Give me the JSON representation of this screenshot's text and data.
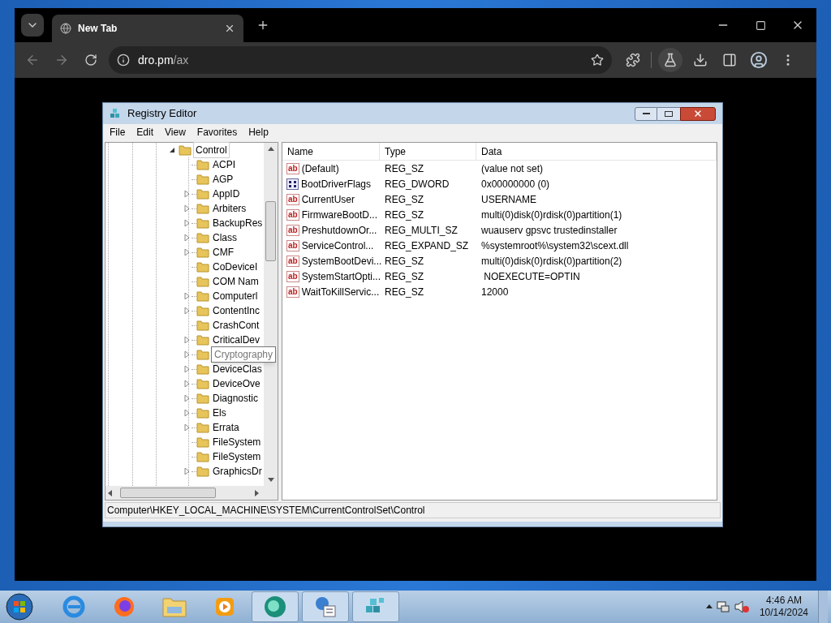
{
  "browser": {
    "tab": {
      "title": "New Tab"
    },
    "url": {
      "host": "dro.pm",
      "path": "/ax"
    }
  },
  "regedit": {
    "title": "Registry Editor",
    "menu": [
      "File",
      "Edit",
      "View",
      "Favorites",
      "Help"
    ],
    "tree": {
      "label": "Control",
      "expanded": true,
      "selected": false,
      "children": [
        {
          "label": "ACPI",
          "expandable": false,
          "tooltip": false
        },
        {
          "label": "AGP",
          "expandable": false,
          "tooltip": false
        },
        {
          "label": "AppID",
          "expandable": true,
          "tooltip": false
        },
        {
          "label": "Arbiters",
          "expandable": true,
          "tooltip": false
        },
        {
          "label": "BackupRes",
          "expandable": true,
          "tooltip": false
        },
        {
          "label": "Class",
          "expandable": true,
          "tooltip": false
        },
        {
          "label": "CMF",
          "expandable": true,
          "tooltip": false
        },
        {
          "label": "CoDeviceI",
          "expandable": false,
          "tooltip": false
        },
        {
          "label": "COM Nam",
          "expandable": false,
          "tooltip": false
        },
        {
          "label": "Computerl",
          "expandable": true,
          "tooltip": false
        },
        {
          "label": "ContentInc",
          "expandable": true,
          "tooltip": false
        },
        {
          "label": "CrashCont",
          "expandable": false,
          "tooltip": false
        },
        {
          "label": "CriticalDev",
          "expandable": true,
          "tooltip": false
        },
        {
          "label": "Cryptography",
          "expandable": true,
          "tooltip": true
        },
        {
          "label": "DeviceClas",
          "expandable": true,
          "tooltip": false
        },
        {
          "label": "DeviceOve",
          "expandable": true,
          "tooltip": false
        },
        {
          "label": "Diagnostic",
          "expandable": true,
          "tooltip": false
        },
        {
          "label": "Els",
          "expandable": true,
          "tooltip": false
        },
        {
          "label": "Errata",
          "expandable": true,
          "tooltip": false
        },
        {
          "label": "FileSystem",
          "expandable": false,
          "tooltip": false
        },
        {
          "label": "FileSystem",
          "expandable": false,
          "tooltip": false
        },
        {
          "label": "GraphicsDr",
          "expandable": true,
          "tooltip": false
        }
      ]
    },
    "columns": [
      "Name",
      "Type",
      "Data"
    ],
    "values": [
      {
        "kind": "string",
        "icon": "ab",
        "name": "(Default)",
        "type": "REG_SZ",
        "data": "(value not set)"
      },
      {
        "kind": "binary",
        "name": "BootDriverFlags",
        "type": "REG_DWORD",
        "data": "0x00000000 (0)"
      },
      {
        "kind": "string",
        "icon": "ab",
        "name": "CurrentUser",
        "type": "REG_SZ",
        "data": "USERNAME"
      },
      {
        "kind": "string",
        "icon": "ab",
        "name": "FirmwareBootD...",
        "type": "REG_SZ",
        "data": "multi(0)disk(0)rdisk(0)partition(1)"
      },
      {
        "kind": "string",
        "icon": "ab",
        "name": "PreshutdownOr...",
        "type": "REG_MULTI_SZ",
        "data": "wuauserv gpsvc trustedinstaller"
      },
      {
        "kind": "string",
        "icon": "ab",
        "name": "ServiceControl...",
        "type": "REG_EXPAND_SZ",
        "data": "%systemroot%\\system32\\scext.dll"
      },
      {
        "kind": "string",
        "icon": "ab",
        "name": "SystemBootDevi...",
        "type": "REG_SZ",
        "data": "multi(0)disk(0)rdisk(0)partition(2)"
      },
      {
        "kind": "string",
        "icon": "ab",
        "name": "SystemStartOpti...",
        "type": "REG_SZ",
        "data": " NOEXECUTE=OPTIN"
      },
      {
        "kind": "string",
        "icon": "ab",
        "name": "WaitToKillServic...",
        "type": "REG_SZ",
        "data": "12000"
      }
    ],
    "status_bar": "Computer\\HKEY_LOCAL_MACHINE\\SYSTEM\\CurrentControlSet\\Control"
  },
  "taskbar": {
    "apps": [
      {
        "kind": "ie",
        "active": false
      },
      {
        "kind": "firefox",
        "active": false
      },
      {
        "kind": "folder",
        "active": false
      },
      {
        "kind": "media",
        "active": false
      },
      {
        "kind": "circle",
        "active": true
      },
      {
        "kind": "network",
        "active": true
      },
      {
        "kind": "registry",
        "active": true
      }
    ],
    "time": "4:46 AM",
    "date": "10/14/2024"
  }
}
